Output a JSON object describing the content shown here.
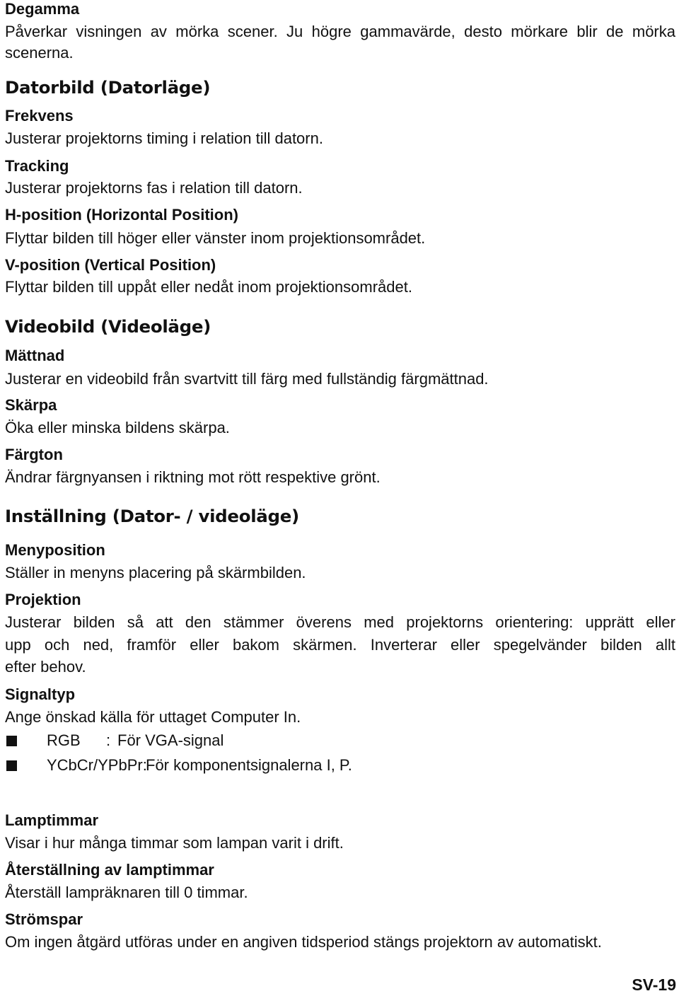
{
  "page": {
    "page_number": "SV-19"
  },
  "intro": {
    "degamma_title": "Degamma",
    "degamma_body_1": "Påverkar visningen av mörka scener. Ju högre gammavärde, desto mörkare blir de mörka",
    "degamma_body_2": "scenerna."
  },
  "computer_section": {
    "heading": "Datorbild (Datorläge)",
    "items": [
      {
        "title": "Frekvens",
        "body": "Justerar projektorns timing i relation till datorn."
      },
      {
        "title": "Tracking",
        "body": "Justerar projektorns fas i relation till datorn."
      },
      {
        "title": "H-position (Horizontal Position)",
        "body": "Flyttar bilden till höger eller vänster inom projektionsområdet."
      },
      {
        "title": "V-position (Vertical Position)",
        "body": "Flyttar bilden till uppåt eller nedåt inom projektionsområdet."
      }
    ]
  },
  "video_section": {
    "heading": "Videobild (Videoläge)",
    "items": [
      {
        "title": "Mättnad",
        "body": "Justerar en videobild från svartvitt till färg med fullständig färgmättnad."
      },
      {
        "title": "Skärpa",
        "body": "Öka eller minska bildens skärpa."
      },
      {
        "title": "Färgton",
        "body": "Ändrar färgnyansen i riktning mot rött respektive grönt."
      }
    ]
  },
  "settings_section": {
    "heading": "Inställning (Dator- / videoläge)",
    "menyposition": {
      "title": "Menyposition",
      "body": "Ställer in menyns placering på skärmbilden."
    },
    "projektion": {
      "title": "Projektion",
      "body_lines": [
        "Justerar bilden så att den stämmer överens med projektorns orientering: upprätt eller",
        "upp och ned, framför eller bakom skärmen. Inverterar eller spegelvänder bilden allt",
        "efter behov."
      ]
    },
    "signaltyp": {
      "title": "Signaltyp",
      "body": "Ange önskad källa för uttaget Computer In.",
      "options": [
        {
          "label": "RGB",
          "separator": ":",
          "desc": "För VGA-signal"
        },
        {
          "label": "YCbCr/YPbPr:",
          "separator": "",
          "desc": "För komponentsignalerna I, P."
        }
      ],
      "bullet_icon": "square-bullet"
    },
    "lamptimmar": {
      "title": "Lamptimmar",
      "body": "Visar i hur många timmar som lampan varit i drift."
    },
    "aterstallning": {
      "title": "Återställning av lamptimmar",
      "body": "Återställ lampräknaren till 0 timmar."
    },
    "stromspar": {
      "title": "Strömspar",
      "body": "Om ingen åtgärd utföras under en angiven tidsperiod stängs projektorn av automatiskt."
    }
  }
}
